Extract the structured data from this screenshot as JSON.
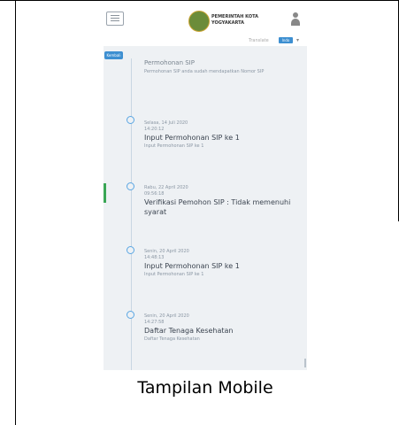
{
  "header": {
    "logo_line1": "PEMERINTAH KOTA",
    "logo_line2": "YOGYAKARTA",
    "language_label": "Translate",
    "language_button": "Indo",
    "back_button": "Kembali"
  },
  "timeline": [
    {
      "date": "",
      "title": "Permohonan SIP",
      "subtitle": "Permohonan SIP anda sudah mendapatkan Nomor SIP"
    },
    {
      "date": "Selasa, 14 Juli 2020",
      "time": "14:20:12",
      "title": "Input Permohonan SIP ke 1",
      "subtitle": "Input Permohonan SIP ke 1"
    },
    {
      "date": "Rabu, 22 April 2020",
      "time": "09:56:18",
      "title": "Verifikasi Pemohon SIP : Tidak memenuhi syarat",
      "subtitle": ""
    },
    {
      "date": "Senin, 20 April 2020",
      "time": "14:48:13",
      "title": "Input Permohonan SIP ke 1",
      "subtitle": "Input Permohonan SIP ke 1"
    },
    {
      "date": "Senin, 20 April 2020",
      "time": "14:27:58",
      "title": "Daftar Tenaga Kesehatan",
      "subtitle": "Daftar Tenaga Kesehatan"
    }
  ],
  "caption": "Tampilan Mobile",
  "colors": {
    "accent_blue": "#3d8fd1",
    "timeline_dot": "#5aa6e3",
    "marker_green": "#3aa655"
  }
}
